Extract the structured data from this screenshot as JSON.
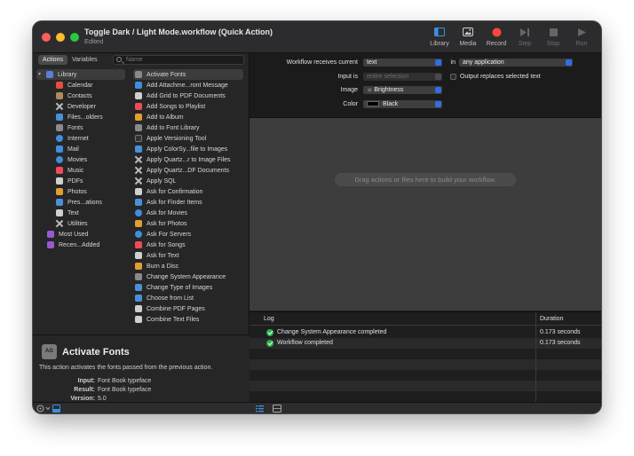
{
  "window": {
    "title": "Toggle Dark / Light Mode.workflow (Quick Action)",
    "subtitle": "Edited"
  },
  "toolbar": {
    "library": "Library",
    "media": "Media",
    "record": "Record",
    "step": "Step",
    "stop": "Stop",
    "run": "Run"
  },
  "library_tabs": {
    "actions": "Actions",
    "variables": "Variables",
    "search_placeholder": "Name"
  },
  "categories": [
    {
      "label": "Library",
      "color": "#5b7fd6"
    },
    {
      "label": "Calendar",
      "color": "#e74c3c"
    },
    {
      "label": "Contacts",
      "color": "#b08a5a"
    },
    {
      "label": "Developer",
      "color": "#bbbbbb"
    },
    {
      "label": "Files...olders",
      "color": "#4a90d9"
    },
    {
      "label": "Fonts",
      "color": "#8a8a8a"
    },
    {
      "label": "Internet",
      "color": "#3d8fe0"
    },
    {
      "label": "Mail",
      "color": "#3d8fe0"
    },
    {
      "label": "Movies",
      "color": "#3d8fe0"
    },
    {
      "label": "Music",
      "color": "#f04a5a"
    },
    {
      "label": "PDFs",
      "color": "#d0d0d0"
    },
    {
      "label": "Photos",
      "color": "#e0a030"
    },
    {
      "label": "Pres...ations",
      "color": "#4a90d9"
    },
    {
      "label": "Text",
      "color": "#d0d0d0"
    },
    {
      "label": "Utilities",
      "color": "#bbbbbb"
    },
    {
      "label": "Most Used",
      "color": "#9b59d0"
    },
    {
      "label": "Recen...Added",
      "color": "#9b59d0"
    }
  ],
  "actions": [
    {
      "label": "Activate Fonts",
      "color": "#8a8a8a"
    },
    {
      "label": "Add Attachme...ront Message",
      "color": "#3d8fe0"
    },
    {
      "label": "Add Grid to PDF Documents",
      "color": "#d0d0d0"
    },
    {
      "label": "Add Songs to Playlist",
      "color": "#f04a5a"
    },
    {
      "label": "Add to Album",
      "color": "#e0a030"
    },
    {
      "label": "Add to Font Library",
      "color": "#8a8a8a"
    },
    {
      "label": "Apple Versioning Tool",
      "color": "#333333"
    },
    {
      "label": "Apply ColorSy...file to Images",
      "color": "#4a90d9"
    },
    {
      "label": "Apply Quartz...r to Image Files",
      "color": "#bbbbbb"
    },
    {
      "label": "Apply Quartz...DF Documents",
      "color": "#bbbbbb"
    },
    {
      "label": "Apply SQL",
      "color": "#bbbbbb"
    },
    {
      "label": "Ask for Confirmation",
      "color": "#d0d0d0"
    },
    {
      "label": "Ask for Finder Items",
      "color": "#4a90d9"
    },
    {
      "label": "Ask for Movies",
      "color": "#3d8fe0"
    },
    {
      "label": "Ask for Photos",
      "color": "#e0a030"
    },
    {
      "label": "Ask For Servers",
      "color": "#3d8fe0"
    },
    {
      "label": "Ask for Songs",
      "color": "#f04a5a"
    },
    {
      "label": "Ask for Text",
      "color": "#d0d0d0"
    },
    {
      "label": "Burn a Disc",
      "color": "#e0a030"
    },
    {
      "label": "Change System Appearance",
      "color": "#8a8a8a"
    },
    {
      "label": "Change Type of Images",
      "color": "#4a90d9"
    },
    {
      "label": "Choose from List",
      "color": "#4a90d9"
    },
    {
      "label": "Combine PDF Pages",
      "color": "#d0d0d0"
    },
    {
      "label": "Combine Text Files",
      "color": "#d0d0d0"
    }
  ],
  "description": {
    "icon_text": "AG",
    "name": "Activate Fonts",
    "text": "This action activates the fonts passed from the previous action.",
    "input_label": "Input:",
    "input_value": "Font Book typeface",
    "result_label": "Result:",
    "result_value": "Font Book typeface",
    "version_label": "Version:",
    "version_value": "5.0"
  },
  "workflow": {
    "receives_label": "Workflow receives current",
    "receives_value": "text",
    "in_label": "in",
    "in_value": "any application",
    "input_is_label": "Input is",
    "input_is_value": "entire selection",
    "output_replaces_label": "Output replaces selected text",
    "image_label": "Image",
    "image_value": "☼ Brightness",
    "color_label": "Color",
    "color_value": "Black",
    "drop_hint": "Drag actions or files here to build your workflow."
  },
  "log": {
    "log_header": "Log",
    "duration_header": "Duration",
    "entries": [
      {
        "message": "Change System Appearance completed",
        "duration": "0.173 seconds"
      },
      {
        "message": "Workflow completed",
        "duration": "0.173 seconds"
      }
    ]
  },
  "colors": {
    "accent": "#2d6ee6",
    "record": "#ff453a",
    "success": "#28b44a"
  }
}
